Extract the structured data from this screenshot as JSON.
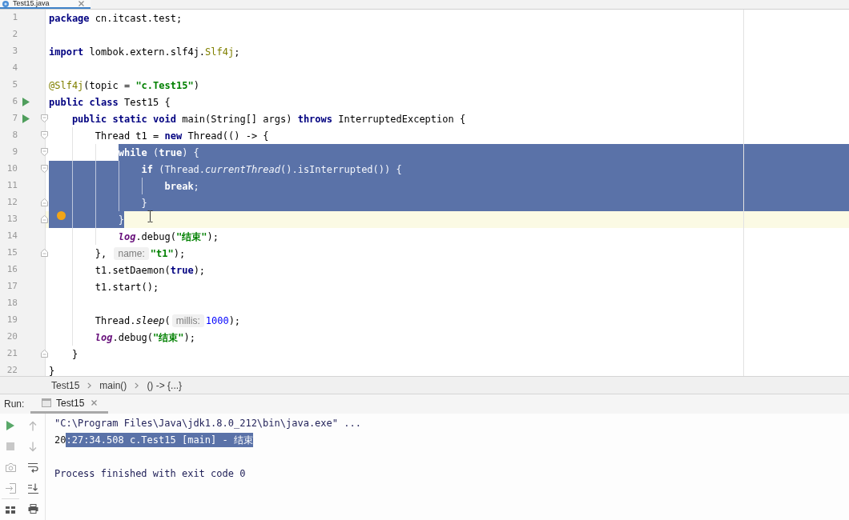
{
  "editor_tabs": [
    {
      "label": "Test15.java",
      "selected": true
    }
  ],
  "editor": {
    "lines": [
      {
        "number": "1",
        "tokens": [
          {
            "kind": "keyword",
            "text": "package"
          },
          {
            "kind": "plain",
            "text": " cn.itcast.test;"
          }
        ],
        "run": false,
        "bulb": false,
        "current": false,
        "selected": false
      },
      {
        "number": "2",
        "run": false,
        "bulb": false,
        "current": false,
        "selected": false
      },
      {
        "number": "3",
        "tokens": [
          {
            "kind": "keyword",
            "text": "import"
          },
          {
            "kind": "plain",
            "text": " lombok.extern.slf4j."
          },
          {
            "kind": "annotation",
            "text": "Slf4j"
          },
          {
            "kind": "plain",
            "text": ";"
          }
        ],
        "run": false,
        "bulb": false,
        "current": false,
        "selected": false
      },
      {
        "number": "4",
        "run": false,
        "bulb": false,
        "current": false,
        "selected": false
      },
      {
        "number": "5",
        "tokens": [
          {
            "kind": "annotation",
            "text": "@Slf4j"
          },
          {
            "kind": "plain",
            "text": "(topic = "
          },
          {
            "kind": "string",
            "text": "\"c.Test15\""
          },
          {
            "kind": "plain",
            "text": ")"
          }
        ],
        "run": false,
        "bulb": false,
        "current": false,
        "selected": false
      },
      {
        "number": "6",
        "tokens": [
          {
            "kind": "keyword",
            "text": "public class"
          },
          {
            "kind": "plain",
            "text": " Test15 {"
          }
        ],
        "run": true,
        "bulb": false,
        "current": false,
        "selected": false,
        "children": [
          {
            "number": "7",
            "kind": "open",
            "tokens": [
              {
                "kind": "keyword",
                "text": "public static void"
              },
              {
                "kind": "plain",
                "text": " main(String[] args) "
              },
              {
                "kind": "keyword",
                "text": "throws"
              },
              {
                "kind": "plain",
                "text": " InterruptedException {"
              }
            ],
            "run": true,
            "bulb": false,
            "current": false,
            "selected": false,
            "children": [
              {
                "number": "8",
                "kind": "open",
                "tokens": [
                  {
                    "kind": "plain",
                    "text": "Thread t1 = "
                  },
                  {
                    "kind": "keyword",
                    "text": "new"
                  },
                  {
                    "kind": "plain",
                    "text": " Thread(() -> {"
                  }
                ],
                "run": false,
                "bulb": false,
                "current": false,
                "selected": false,
                "children": [
                  {
                    "number": "9",
                    "kind": "open",
                    "tokens": [
                      {
                        "kind": "keyword",
                        "text": "while"
                      },
                      {
                        "kind": "plain",
                        "text": " ("
                      },
                      {
                        "kind": "keyword",
                        "text": "true"
                      },
                      {
                        "kind": "plain",
                        "text": ") {"
                      }
                    ],
                    "run": false,
                    "bulb": false,
                    "current": false,
                    "selected": true,
                    "children": [
                      {
                        "number": "10",
                        "kind": "open",
                        "tokens": [
                          {
                            "kind": "keyword",
                            "text": "if"
                          },
                          {
                            "kind": "plain",
                            "text": " (Thread."
                          },
                          {
                            "kind": "static-call",
                            "text": "currentThread"
                          },
                          {
                            "kind": "plain",
                            "text": "().isInterrupted()) {"
                          }
                        ],
                        "run": false,
                        "bulb": false,
                        "current": false,
                        "selected": true,
                        "children": [
                          {
                            "number": "11",
                            "tokens": [
                              {
                                "kind": "keyword",
                                "text": "break"
                              },
                              {
                                "kind": "plain",
                                "text": ";"
                              }
                            ],
                            "run": false,
                            "bulb": false,
                            "current": false,
                            "selected": true
                          }
                        ]
                      },
                      {
                        "number": "12",
                        "kind": "close",
                        "tokens": [
                          {
                            "kind": "plain",
                            "text": "}"
                          }
                        ],
                        "run": false,
                        "bulb": false,
                        "current": false,
                        "selected": true
                      }
                    ]
                  },
                  {
                    "number": "13",
                    "kind": "close",
                    "tokens": [
                      {
                        "kind": "plain",
                        "text": "}"
                      }
                    ],
                    "run": false,
                    "bulb": true,
                    "current": true,
                    "selected": true
                  },
                  {
                    "number": "14",
                    "tokens": [
                      {
                        "kind": "static-field",
                        "text": "log"
                      },
                      {
                        "kind": "plain",
                        "text": ".debug("
                      },
                      {
                        "kind": "string",
                        "text": "\"结束\""
                      },
                      {
                        "kind": "plain",
                        "text": ");"
                      }
                    ],
                    "run": false,
                    "bulb": false,
                    "current": false,
                    "selected": false
                  }
                ]
              },
              {
                "number": "15",
                "kind": "close",
                "tokens": [
                  {
                    "kind": "plain",
                    "text": "}, "
                  },
                  {
                    "kind": "hint",
                    "text": "name:"
                  },
                  {
                    "kind": "string",
                    "text": "\"t1\""
                  },
                  {
                    "kind": "plain",
                    "text": ");"
                  }
                ],
                "run": false,
                "bulb": false,
                "current": false,
                "selected": false
              },
              {
                "number": "16",
                "tokens": [
                  {
                    "kind": "plain",
                    "text": "t1.setDaemon("
                  },
                  {
                    "kind": "keyword",
                    "text": "true"
                  },
                  {
                    "kind": "plain",
                    "text": ");"
                  }
                ],
                "run": false,
                "bulb": false,
                "current": false,
                "selected": false
              },
              {
                "number": "17",
                "tokens": [
                  {
                    "kind": "plain",
                    "text": "t1.start();"
                  }
                ],
                "run": false,
                "bulb": false,
                "current": false,
                "selected": false
              },
              {
                "number": "18",
                "run": false,
                "bulb": false,
                "current": false,
                "selected": false
              },
              {
                "number": "19",
                "tokens": [
                  {
                    "kind": "plain",
                    "text": "Thread."
                  },
                  {
                    "kind": "static-call",
                    "text": "sleep"
                  },
                  {
                    "kind": "plain",
                    "text": "("
                  },
                  {
                    "kind": "hint",
                    "text": "millis:"
                  },
                  {
                    "kind": "number",
                    "text": "1000"
                  },
                  {
                    "kind": "plain",
                    "text": ");"
                  }
                ],
                "run": false,
                "bulb": false,
                "current": false,
                "selected": false
              },
              {
                "number": "20",
                "tokens": [
                  {
                    "kind": "static-field",
                    "text": "log"
                  },
                  {
                    "kind": "plain",
                    "text": ".debug("
                  },
                  {
                    "kind": "string",
                    "text": "\"结束\""
                  },
                  {
                    "kind": "plain",
                    "text": ");"
                  }
                ],
                "run": false,
                "bulb": false,
                "current": false,
                "selected": false
              }
            ]
          },
          {
            "number": "21",
            "kind": "close",
            "tokens": [
              {
                "kind": "plain",
                "text": "}"
              }
            ],
            "run": false,
            "bulb": false,
            "current": false,
            "selected": false
          }
        ]
      },
      {
        "number": "22",
        "tokens": [
          {
            "kind": "plain",
            "text": "}"
          }
        ],
        "run": false,
        "bulb": false,
        "current": false,
        "selected": false
      }
    ]
  },
  "breadcrumbs": [
    "Test15",
    "main()",
    "() -> {...}"
  ],
  "run_panel": {
    "label": "Run:",
    "tabs": [
      {
        "label": "Test15",
        "selected": true
      }
    ],
    "output": [
      {
        "kind": "system",
        "segments": [
          {
            "text": "\"C:\\Program Files\\Java\\jdk1.8.0_212\\bin\\java.exe\" ...",
            "selected": false
          }
        ]
      },
      {
        "kind": "log",
        "segments": [
          {
            "text": "20",
            "selected": false
          },
          {
            "text": ":27:34.508 c.Test15 [main] - 结束",
            "selected": true
          }
        ]
      },
      {
        "kind": "blank"
      },
      {
        "kind": "system",
        "segments": [
          {
            "text": "Process finished with exit code 0",
            "selected": false
          }
        ]
      }
    ]
  }
}
